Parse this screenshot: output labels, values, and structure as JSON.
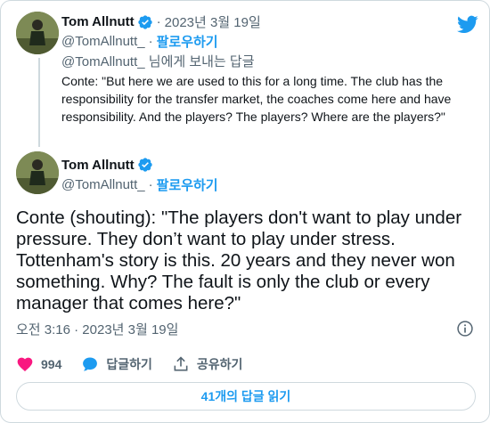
{
  "reply_tweet": {
    "author_name": "Tom Allnutt",
    "date": "2023년 3월 19일",
    "handle": "@TomAllnutt_",
    "follow_label": "팔로우하기",
    "reply_to": "@TomAllnutt_ 님에게 보내는 답글",
    "text": "Conte: \"But here we are used to this for a long time. The club has the responsibility for the transfer market, the coaches come here and have responsibility. And the players? The players? Where are the players?\""
  },
  "main_tweet": {
    "author_name": "Tom Allnutt",
    "handle": "@TomAllnutt_",
    "follow_label": "팔로우하기",
    "text": "Conte (shouting): \"The players don't want to play under pressure. They don’t want to play under stress. Tottenham's story is this. 20 years and they never won something. Why? The fault is only the club or every manager that comes here?\"",
    "timestamp": "오전 3:16 · 2023년 3월 19일"
  },
  "actions": {
    "like_count": "994",
    "reply_label": "답글하기",
    "share_label": "공유하기"
  },
  "read_replies_label": "41개의 답글 읽기",
  "separator": "·",
  "colors": {
    "accent": "#1d9bf0",
    "like": "#f91880",
    "text": "#0f1419",
    "muted": "#536471",
    "border": "#cfd9de"
  },
  "icons": [
    "avatar",
    "verified-badge-icon",
    "twitter-bird-icon",
    "info-icon",
    "heart-icon",
    "reply-bubble-icon",
    "share-icon"
  ]
}
